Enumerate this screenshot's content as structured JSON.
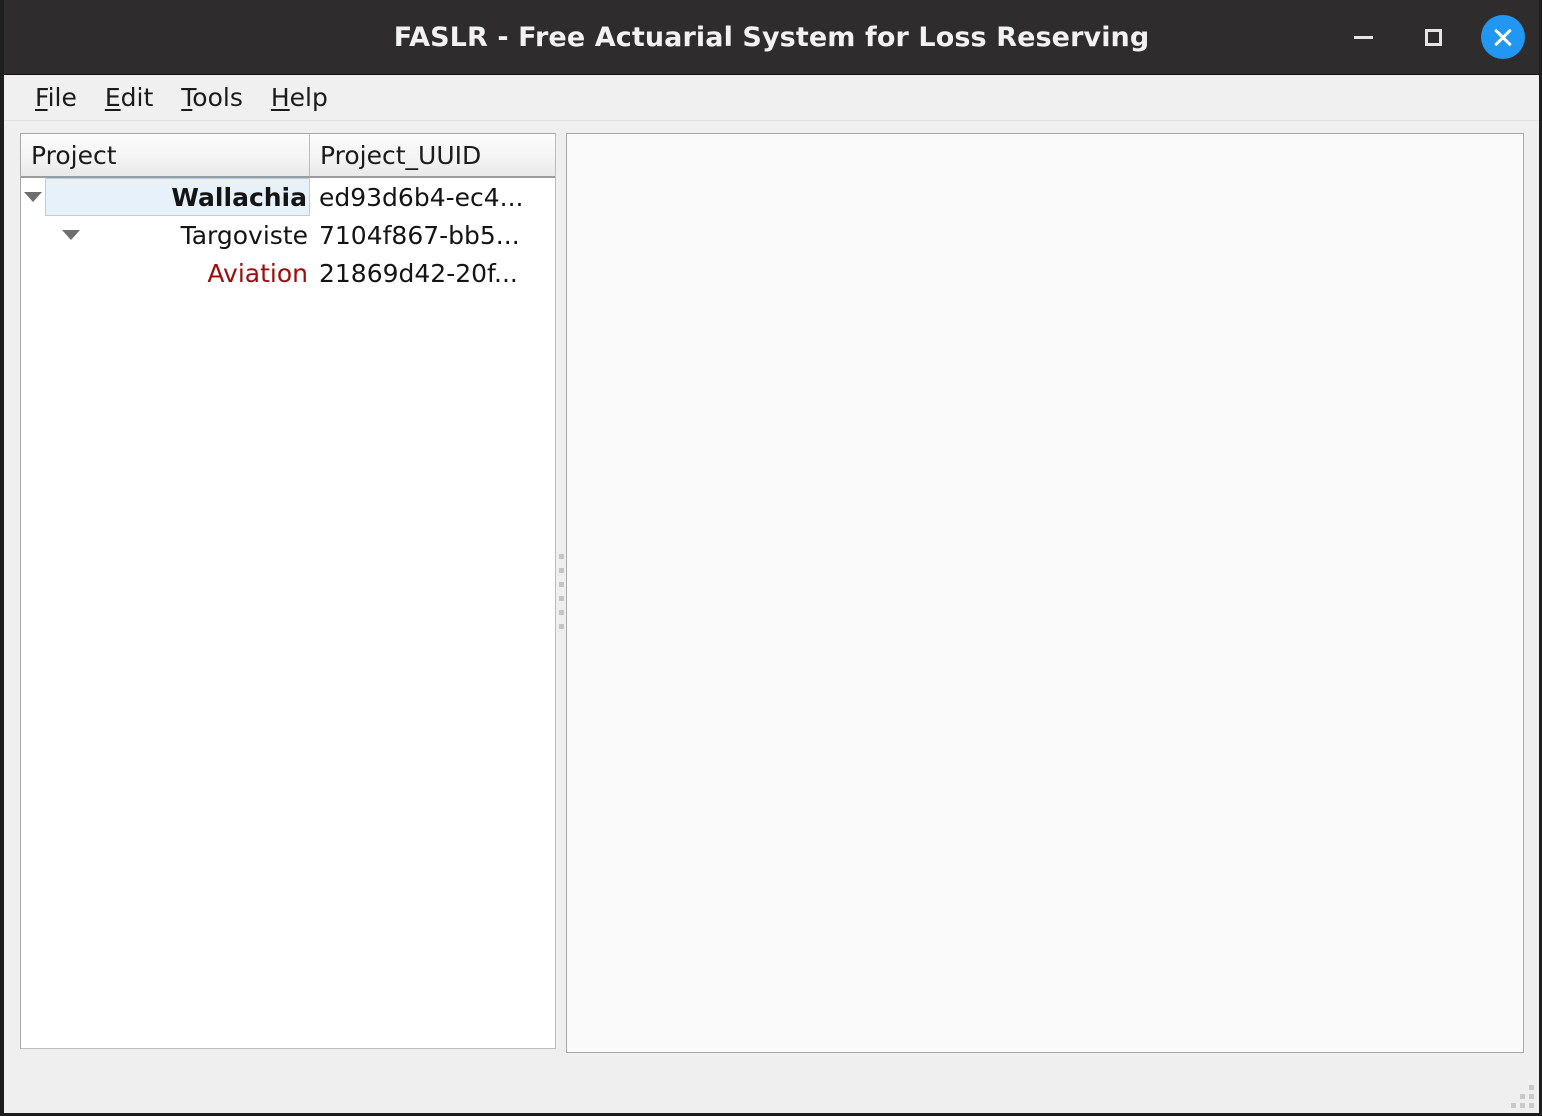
{
  "window": {
    "title": "FASLR - Free Actuarial System for Loss Reserving",
    "controls": {
      "minimize": "minimize",
      "maximize": "maximize",
      "close": "close"
    },
    "accent_color": "#2196f3",
    "titlebar_color": "#2e2c2c",
    "background_color": "#efefef"
  },
  "menubar": {
    "items": [
      {
        "mnemonic": "F",
        "rest": "ile"
      },
      {
        "mnemonic": "E",
        "rest": "dit"
      },
      {
        "mnemonic": "T",
        "rest": "ools"
      },
      {
        "mnemonic": "H",
        "rest": "elp"
      }
    ]
  },
  "project_tree": {
    "columns": [
      {
        "label": "Project"
      },
      {
        "label": "Project_UUID"
      }
    ],
    "rows": [
      {
        "name": "Wallachia",
        "uuid": "ed93d6b4-ec4...",
        "level": 1,
        "expanded": true,
        "has_children": true,
        "selected": true,
        "bold": true,
        "color": "#141414"
      },
      {
        "name": "Targoviste",
        "uuid": "7104f867-bb5...",
        "level": 2,
        "expanded": true,
        "has_children": true,
        "selected": false,
        "bold": false,
        "color": "#141414"
      },
      {
        "name": "Aviation",
        "uuid": "21869d42-20f...",
        "level": 3,
        "expanded": false,
        "has_children": false,
        "selected": false,
        "bold": false,
        "color": "#9e0b0b"
      }
    ],
    "selection_color": "#e6f1fa"
  },
  "right_panel": {
    "content": ""
  }
}
